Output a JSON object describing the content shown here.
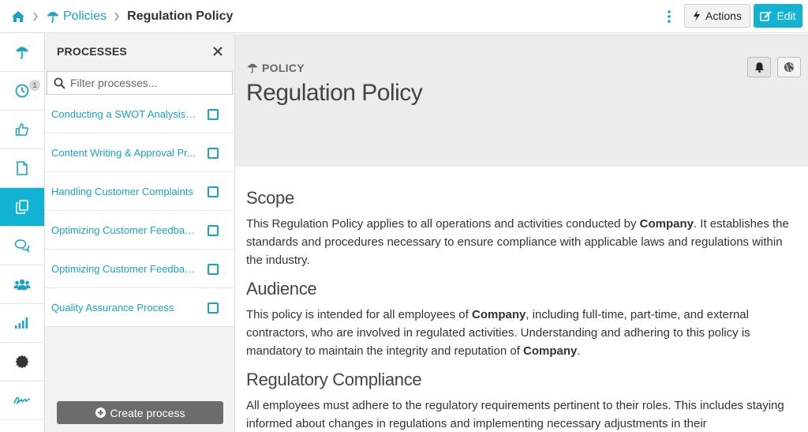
{
  "breadcrumb": {
    "parent": "Policies",
    "current": "Regulation Policy"
  },
  "toolbar": {
    "actions_label": "Actions",
    "edit_label": "Edit"
  },
  "rail": {
    "items": [
      {
        "icon": "umbrella-icon"
      },
      {
        "icon": "clock-icon",
        "badge": "1"
      },
      {
        "icon": "thumbs-up-icon"
      },
      {
        "icon": "file-icon"
      },
      {
        "icon": "copy-icon",
        "active": true
      },
      {
        "icon": "chat-icon"
      },
      {
        "icon": "users-icon"
      },
      {
        "icon": "signal-icon"
      },
      {
        "icon": "badge-icon"
      },
      {
        "icon": "signature-icon"
      }
    ]
  },
  "panel": {
    "title": "PROCESSES",
    "filter_placeholder": "Filter processes...",
    "items": [
      {
        "label": "Conducting a SWOT Analysis f..."
      },
      {
        "label": "Content Writing & Approval Pr..."
      },
      {
        "label": "Handling Customer Complaints"
      },
      {
        "label": "Optimizing Customer Feedbac..."
      },
      {
        "label": "Optimizing Customer Feedbac..."
      },
      {
        "label": "Quality Assurance Process"
      }
    ],
    "create_label": "Create process"
  },
  "hero": {
    "kind": "POLICY",
    "title": "Regulation Policy"
  },
  "sections": [
    {
      "heading": "Scope",
      "p1": "This Regulation Policy applies to all operations and activities conducted by ",
      "b1": "Company",
      "p2": ". It establishes the standards and procedures necessary to ensure compliance with applicable laws and regulations within the industry."
    },
    {
      "heading": "Audience",
      "p1": "This policy is intended for all employees of ",
      "b1": "Company",
      "p2": ", including full-time, part-time, and external contractors, who are involved in regulated activities. Understanding and adhering to this policy is mandatory to maintain the integrity and reputation of ",
      "b2": "Company",
      "p3": "."
    },
    {
      "heading": "Regulatory Compliance",
      "p1": "All employees must adhere to the regulatory requirements pertinent to their roles. This includes staying informed about changes in regulations and implementing necessary adjustments in their"
    }
  ],
  "colors": {
    "accent": "#12b2d2",
    "link": "#1aa3c9"
  }
}
